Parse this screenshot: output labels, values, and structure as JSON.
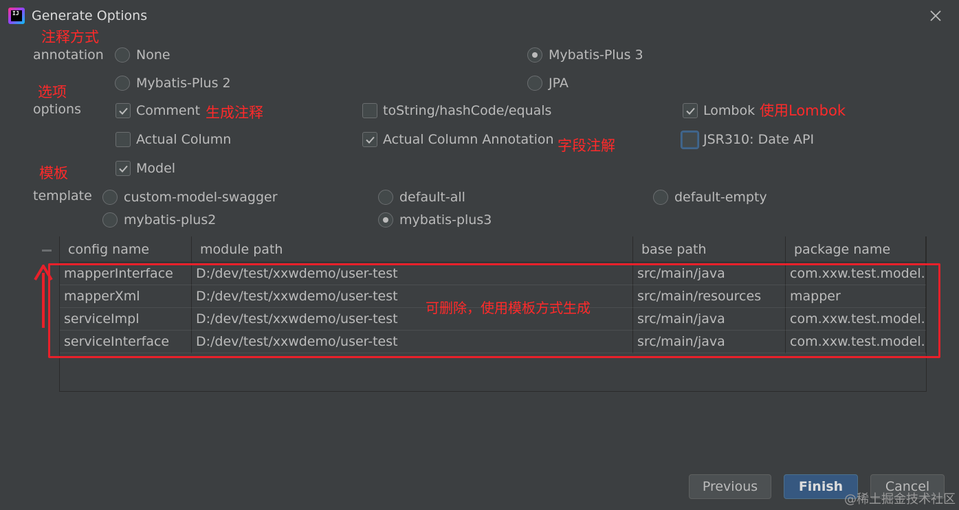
{
  "window": {
    "title": "Generate Options"
  },
  "annotations": {
    "annotation_method": "注释方式",
    "options": "选项",
    "template": "模板",
    "generate_comment": "生成注释",
    "use_lombok": "使用Lombok",
    "field_annotation": "字段注解",
    "table_note": "可删除，使用模板方式生成"
  },
  "annotation": {
    "label": "annotation",
    "options": [
      {
        "label": "None",
        "selected": false
      },
      {
        "label": "Mybatis-Plus 3",
        "selected": true
      },
      {
        "label": "Mybatis-Plus 2",
        "selected": false
      },
      {
        "label": "JPA",
        "selected": false
      }
    ]
  },
  "options": {
    "label": "options",
    "items": [
      {
        "label": "Comment",
        "checked": true
      },
      {
        "label": "toString/hashCode/equals",
        "checked": false
      },
      {
        "label": "Lombok",
        "checked": true
      },
      {
        "label": "Actual Column",
        "checked": false
      },
      {
        "label": "Actual Column Annotation",
        "checked": true
      },
      {
        "label": "JSR310: Date API",
        "checked": false
      },
      {
        "label": "Model",
        "checked": true
      }
    ]
  },
  "template": {
    "label": "template",
    "options": [
      {
        "label": "custom-model-swagger",
        "selected": false
      },
      {
        "label": "default-all",
        "selected": false
      },
      {
        "label": "default-empty",
        "selected": false
      },
      {
        "label": "mybatis-plus2",
        "selected": false
      },
      {
        "label": "mybatis-plus3",
        "selected": true
      }
    ]
  },
  "table": {
    "columns": [
      "config name",
      "module path",
      "base path",
      "package name"
    ],
    "rows": [
      [
        "mapperInterface",
        "D:/dev/test/xxwdemo/user-test",
        "src/main/java",
        "com.xxw.test.model.st"
      ],
      [
        "mapperXml",
        "D:/dev/test/xxwdemo/user-test",
        "src/main/resources",
        "mapper"
      ],
      [
        "serviceImpl",
        "D:/dev/test/xxwdemo/user-test",
        "src/main/java",
        "com.xxw.test.model.st"
      ],
      [
        "serviceInterface",
        "D:/dev/test/xxwdemo/user-test",
        "src/main/java",
        "com.xxw.test.model.st"
      ]
    ]
  },
  "buttons": {
    "previous": "Previous",
    "finish": "Finish",
    "cancel": "Cancel"
  },
  "watermark": "@稀土掘金技术社区",
  "colors": {
    "background": "#3c3f41",
    "annotation_red": "#ff2a2a",
    "primary_button": "#365880"
  }
}
